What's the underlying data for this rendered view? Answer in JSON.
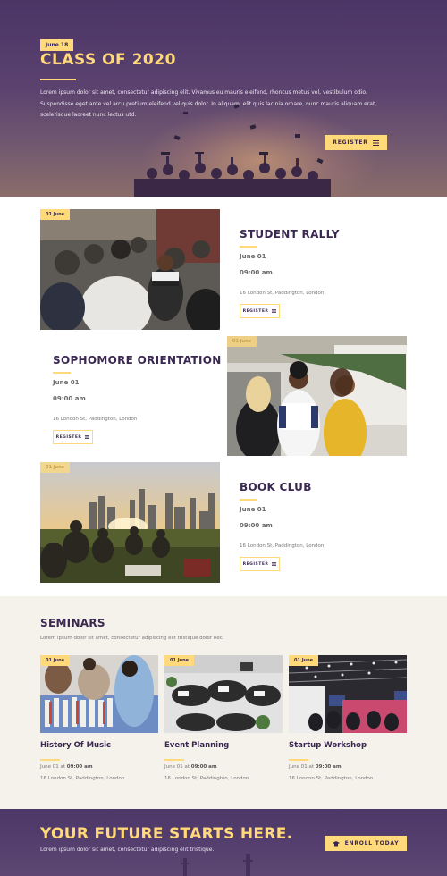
{
  "hero": {
    "badge": "June 18",
    "title": "CLASS OF 2020",
    "text": "Lorem ipsum dolor sit amet, consectetur adipiscing elit. Vivamus eu mauris eleifend, rhoncus metus vel, vestibulum odio. Suspendisse eget ante vel arcu pretium eleifend vel quis dolor. In aliquam, elit quis lacinia ornare, nunc mauris aliquam erat, scelerisque laoreet nunc lectus utd.",
    "button": "REGISTER"
  },
  "events": [
    {
      "badge": "01 June",
      "title": "STUDENT RALLY",
      "date": "June 01",
      "time": "09:00 am",
      "address": "16 London St, Paddington, London",
      "button": "REGISTER"
    },
    {
      "badge": "01 June",
      "title": "SOPHOMORE ORIENTATION",
      "date": "June 01",
      "time": "09:00 am",
      "address": "16 London St, Paddington, London",
      "button": "REGISTER"
    },
    {
      "badge": "01 June",
      "title": "BOOK CLUB",
      "date": "June 01",
      "time": "09:00 am",
      "address": "16 London St, Paddington, London",
      "button": "REGISTER"
    }
  ],
  "seminars": {
    "title": "SEMINARS",
    "subtitle": "Lorem ipsum dolor sit amet, consectetur adipiscing elit tristique dolor nec.",
    "cards": [
      {
        "badge": "01 June",
        "title": "History Of Music",
        "date_prefix": "June 01 at",
        "time": "09:00 am",
        "address": "16 London St, Paddington, London"
      },
      {
        "badge": "01 June",
        "title": "Event Planning",
        "date_prefix": "June 01 at",
        "time": "09:00 am",
        "address": "16 London St, Paddington, London"
      },
      {
        "badge": "01 June",
        "title": "Startup Workshop",
        "date_prefix": "June 01 at",
        "time": "09:00 am",
        "address": "16 London St, Paddington, London"
      }
    ]
  },
  "cta": {
    "title": "YOUR FUTURE STARTS HERE.",
    "subtitle": "Lorem ipsum dolor sit amet, consectetur adipiscing elit tristique.",
    "button": "ENROLL TODAY"
  },
  "colors": {
    "accent": "#ffd97a",
    "primary": "#3a2850",
    "hero_bg": "#4a3566",
    "seminars_bg": "#f5f2ec"
  },
  "icons": {
    "register": "list-icon",
    "enroll": "graduation-cap-icon"
  }
}
